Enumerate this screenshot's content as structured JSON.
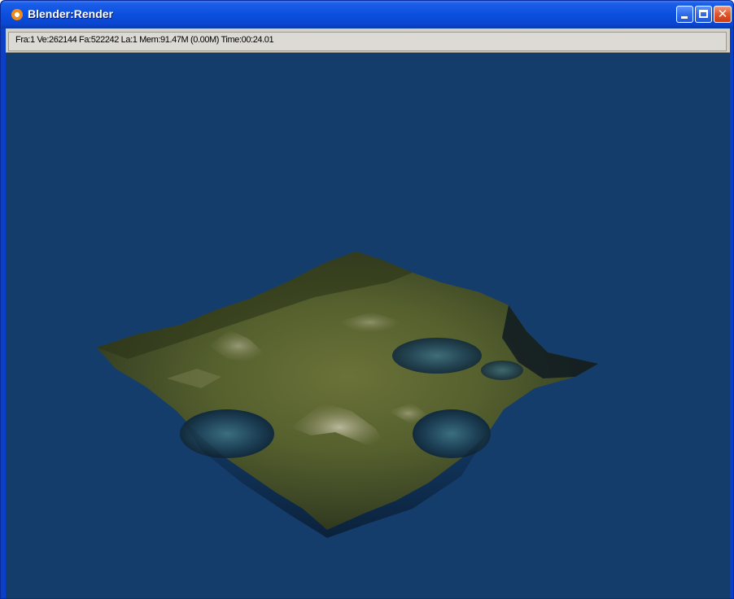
{
  "window": {
    "title": "Blender:Render",
    "icon": "blender-logo-icon",
    "controls": [
      "minimize-icon",
      "maximize-icon",
      "close-icon"
    ]
  },
  "status": {
    "text": "Fra:1  Ve:262144 Fa:522242 La:1 Mem:91.47M (0.00M) Time:00:24.01"
  },
  "render": {
    "background_color": "#143d6b",
    "subject": "terrain"
  }
}
